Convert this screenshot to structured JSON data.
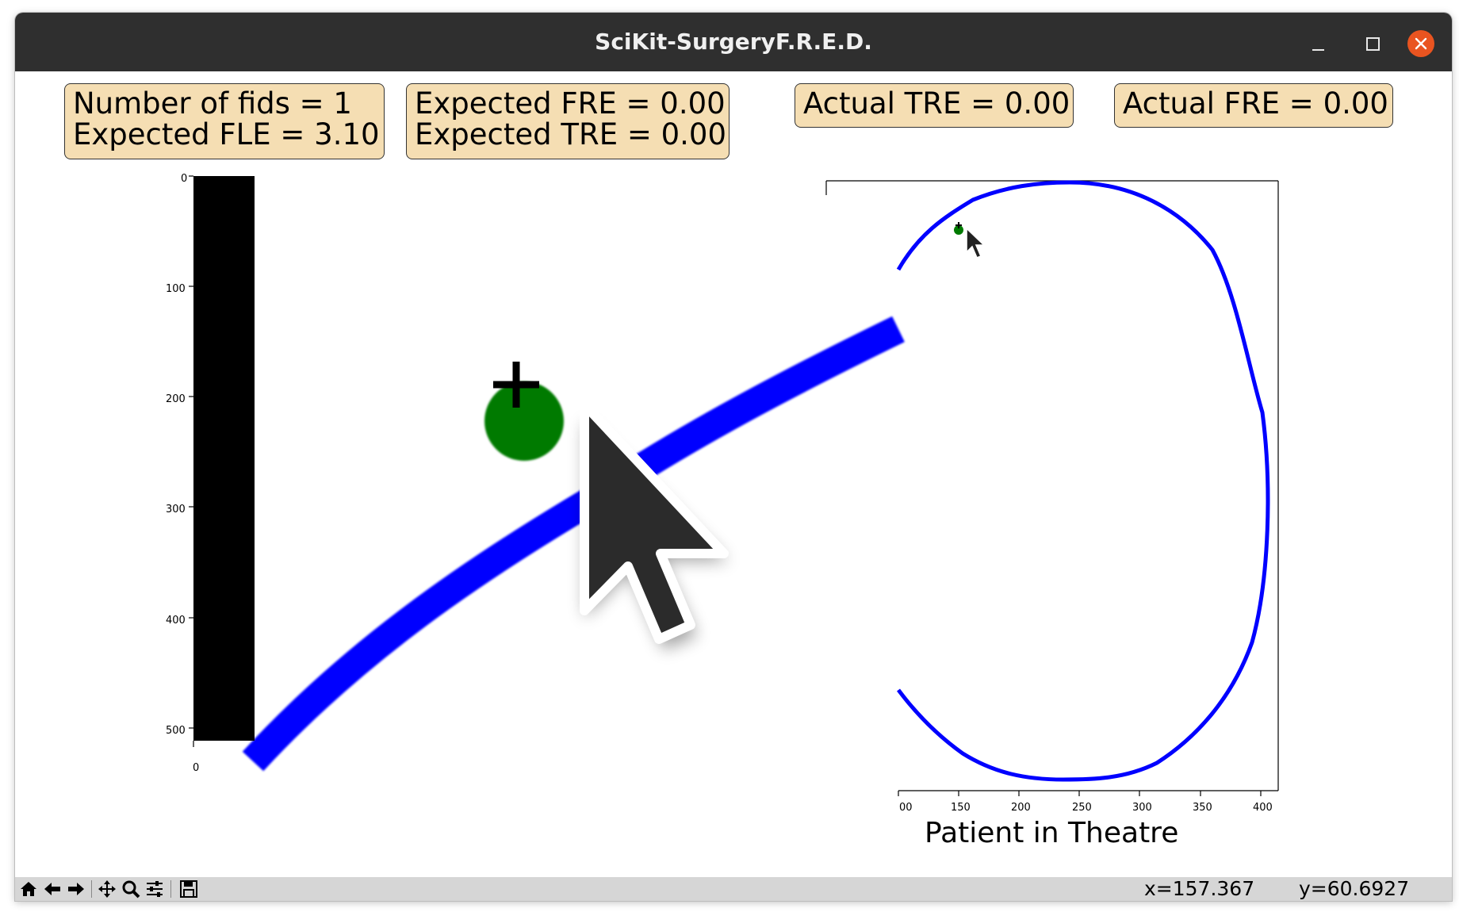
{
  "window": {
    "title": "SciKit-SurgeryF.R.E.D."
  },
  "info_boxes": {
    "fids": {
      "line1": "Number of fids = 1",
      "line2": "Expected FLE = 3.10"
    },
    "expected": {
      "line1": "Expected FRE = 0.00",
      "line2": "Expected TRE = 0.00"
    },
    "actual_tre": "Actual TRE = 0.00",
    "actual_fre": "Actual FRE = 0.00"
  },
  "pre_op_axes": {
    "y_ticks": [
      "0",
      "100",
      "200",
      "300",
      "400",
      "500"
    ],
    "x_ticks": [
      "0"
    ]
  },
  "theatre_axes": {
    "title": "Patient in Theatre",
    "x_ticks": [
      "00",
      "150",
      "200",
      "250",
      "300",
      "350",
      "400"
    ]
  },
  "status": {
    "x": "x=157.367",
    "y": "y=60.6927"
  },
  "toolbar": {
    "items": [
      "home-icon",
      "back-icon",
      "forward-icon",
      "pan-icon",
      "zoom-icon",
      "configure-icon",
      "save-icon"
    ]
  },
  "colors": {
    "outline": "#0000ff",
    "fiducial": "#007a00",
    "box_bg": "#f5deb3",
    "title_bar": "#2f2f2f",
    "close": "#e95420"
  }
}
